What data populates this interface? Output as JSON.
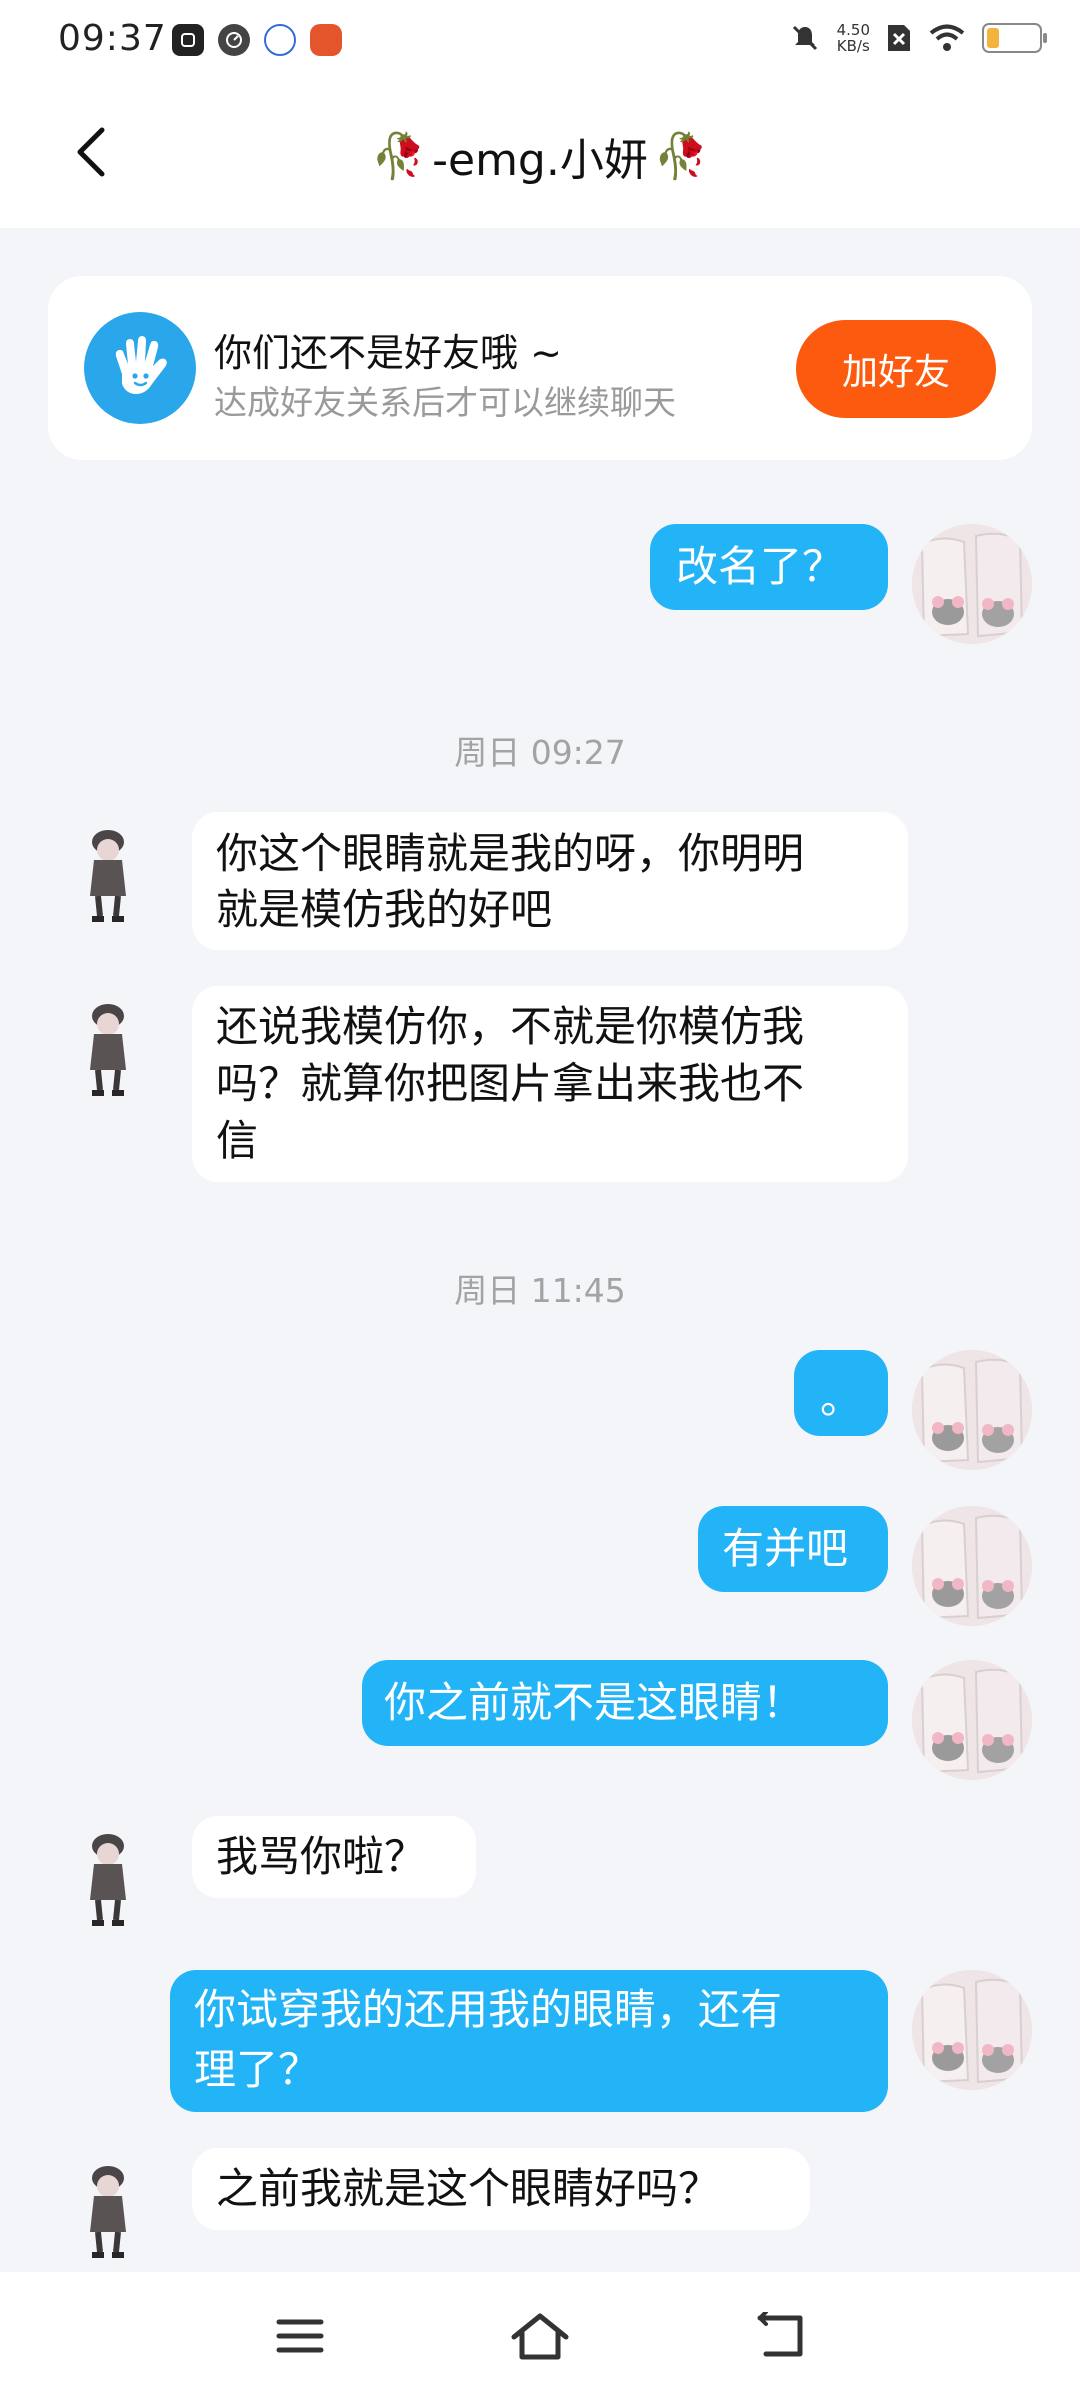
{
  "status_bar": {
    "time": "09:37",
    "net_speed_value": "4.50",
    "net_speed_unit": "KB/s",
    "icons": [
      "watch-app-icon",
      "speed-icon",
      "ifly-icon",
      "game-icon",
      "mute-icon",
      "no-sim-icon",
      "wifi-icon",
      "battery-icon"
    ]
  },
  "header": {
    "title": "-emg.小妍",
    "decoration": "🥀"
  },
  "friend_notice": {
    "title": "你们还不是好友哦 ~",
    "subtitle": "达成好友关系后才可以继续聊天",
    "button": "加好友"
  },
  "timestamps": [
    "周日 09:27",
    "周日 11:45"
  ],
  "messages": [
    {
      "side": "out",
      "text": "改名了？"
    },
    {
      "side": "in",
      "line1": "你这个眼睛就是我的呀，你明明",
      "line2": "就是模仿我的好吧"
    },
    {
      "side": "in",
      "line1": "还说我模仿你，不就是你模仿我",
      "line2": "吗？就算你把图片拿出来我也不",
      "line3": "信"
    },
    {
      "side": "out",
      "text": "。"
    },
    {
      "side": "out",
      "text": "有并吧"
    },
    {
      "side": "out",
      "text": "你之前就不是这眼睛！"
    },
    {
      "side": "in",
      "text": "我骂你啦？"
    },
    {
      "side": "out",
      "line1": "你试穿我的还用我的眼睛，还有",
      "line2": "理了？"
    },
    {
      "side": "in",
      "text": "之前我就是这个眼睛好吗？"
    }
  ],
  "colors": {
    "outgoing_bubble": "#23b3f7",
    "incoming_bubble": "#ffffff",
    "add_friend_button": "#fc5a0f",
    "background": "#f3f5f8"
  }
}
